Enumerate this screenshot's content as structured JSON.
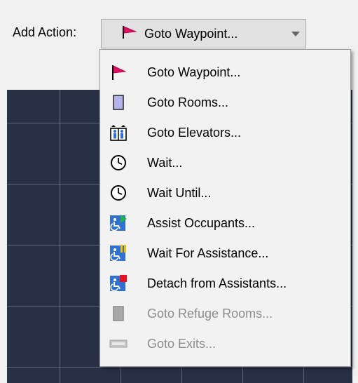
{
  "toolbar": {
    "label": "Add Action:",
    "selected_value": "Goto Waypoint..."
  },
  "menu": {
    "items": [
      {
        "label": "Goto Waypoint...",
        "icon": "waypoint-flag-icon",
        "enabled": true
      },
      {
        "label": "Goto Rooms...",
        "icon": "room-icon",
        "enabled": true
      },
      {
        "label": "Goto Elevators...",
        "icon": "elevator-icon",
        "enabled": true
      },
      {
        "label": "Wait...",
        "icon": "clock-icon",
        "enabled": true
      },
      {
        "label": "Wait Until...",
        "icon": "clock-icon",
        "enabled": true
      },
      {
        "label": "Assist Occupants...",
        "icon": "assist-play-icon",
        "enabled": true
      },
      {
        "label": "Wait For Assistance...",
        "icon": "assist-pause-icon",
        "enabled": true
      },
      {
        "label": "Detach from Assistants...",
        "icon": "assist-stop-icon",
        "enabled": true
      },
      {
        "label": "Goto Refuge Rooms...",
        "icon": "refuge-room-icon",
        "enabled": false
      },
      {
        "label": "Goto Exits...",
        "icon": "exit-sign-icon",
        "enabled": false
      }
    ]
  },
  "colors": {
    "flag": "#e0115f",
    "room": "#b4b4ea",
    "assist_blue": "#3070d0",
    "play": "#22b14c",
    "pause": "#f0c000",
    "stop": "#e81123",
    "canvas": "#283046"
  }
}
